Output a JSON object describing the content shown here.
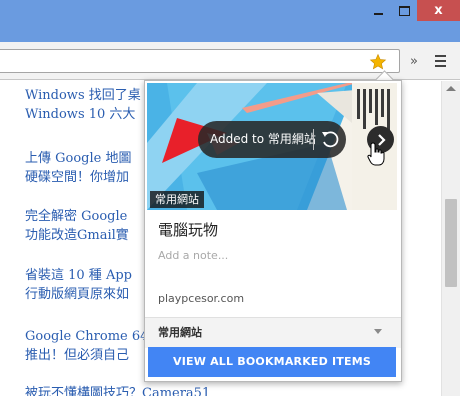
{
  "window": {
    "minimize_icon": "minimize-icon",
    "maximize_icon": "maximize-icon",
    "close_icon": "close-icon",
    "close_glyph": "x",
    "titlebar_color": "#6a9be0",
    "close_color": "#c75050"
  },
  "toolbar": {
    "star_icon": "star-icon",
    "star_color": "#f4b400",
    "extensions_glyph": "»",
    "menu_icon": "hamburger-menu-icon"
  },
  "articles": [
    {
      "line1": "Windows 找回了桌",
      "line2": "Windows 10 六大"
    },
    {
      "line1": "上傳 Google 地圖",
      "line2": "硬碟空間！你增加"
    },
    {
      "line1": "完全解密 Google",
      "line2": "功能改造Gmail實"
    },
    {
      "line1": "省裝這 10 種 App",
      "line2": "行動版網頁原來如"
    },
    {
      "line1": "Google Chrome 64",
      "line2": "推出！但必須自己"
    },
    {
      "line1": "被玩不懂構圖技巧？Camera51",
      "line2": ""
    }
  ],
  "link_color": "#2a5db0",
  "bookmark_bubble": {
    "folder_tag": "常用網站",
    "toast_text": "Added to 常用網站",
    "undo_icon": "undo-icon",
    "next_icon": "chevron-right-icon",
    "title": "電腦玩物",
    "note_placeholder": "Add a note...",
    "url": "playpcesor.com",
    "folder_select": "常用網站",
    "view_all_label": "VIEW ALL BOOKMARKED ITEMS",
    "accent_color": "#4285f4"
  }
}
